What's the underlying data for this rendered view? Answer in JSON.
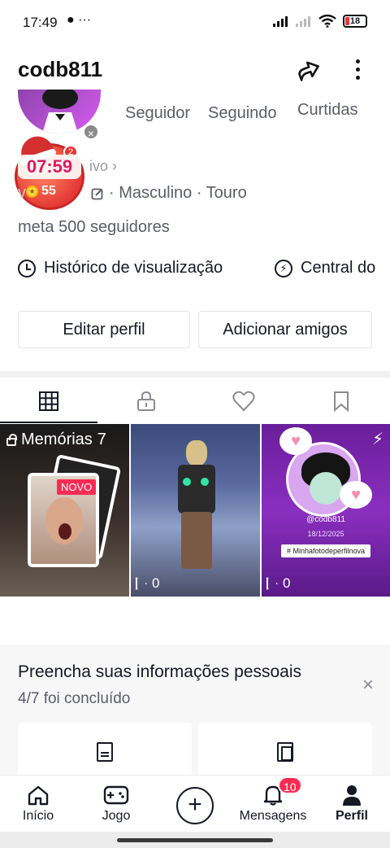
{
  "status_bar": {
    "time": "17:49",
    "left_icons": "● ···",
    "battery": "18"
  },
  "header": {
    "username": "codb811",
    "share_icon": "share-icon",
    "more_icon": "more-icon"
  },
  "stats": {
    "followers_label": "Seguidor",
    "following_label": "Seguindo",
    "likes_label": "Curtidas"
  },
  "timer_widget": {
    "time": "07:59",
    "badge": "2",
    "coins": "55"
  },
  "profile": {
    "bio_hint": "ivo ›",
    "meta_prefix": "v",
    "meta_gender": "· Masculino · Touro",
    "bio": "meta 500 seguidores"
  },
  "shortcuts": {
    "history": "Histórico de visualização",
    "center": "Central do"
  },
  "buttons": {
    "edit": "Editar perfil",
    "add_friends": "Adicionar amigos"
  },
  "tabs": [
    "grid-icon",
    "lock-icon",
    "heart-icon",
    "bookmark-icon"
  ],
  "grid": {
    "memories_label": "Memórias",
    "memories_count": "7",
    "novo": "NOVO",
    "video2_views": "0",
    "video3_views": "0",
    "video3_user": "@codb811",
    "video3_date": "18/12/2025",
    "video3_tag": "# Minhafotodeperfilnova"
  },
  "info_card": {
    "title": "Preencha suas informações pessoais",
    "progress": "4/7 foi concluído",
    "close": "×"
  },
  "bottom_nav": {
    "home": "Início",
    "game": "Jogo",
    "create": "+",
    "messages": "Mensagens",
    "messages_badge": "10",
    "profile": "Perfil"
  },
  "colors": {
    "accent": "#fe2c55",
    "text_primary": "#161823",
    "text_secondary": "#5c5e66"
  }
}
